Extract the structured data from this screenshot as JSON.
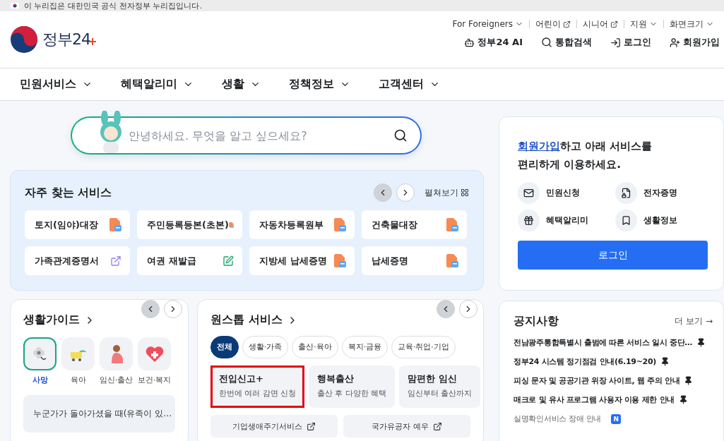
{
  "banner": {
    "text": "이 누리집은 대한민국 공식 전자정부 누리집입니다."
  },
  "logo": {
    "text": "정부24"
  },
  "utility_links": [
    {
      "label": "For Foreigners",
      "kind": "dropdown"
    },
    {
      "label": "어린이",
      "kind": "external"
    },
    {
      "label": "시니어",
      "kind": "external"
    },
    {
      "label": "지원",
      "kind": "dropdown"
    },
    {
      "label": "화면크기",
      "kind": "dropdown"
    }
  ],
  "actions": [
    {
      "label": "정부24 AI",
      "kind": "ai"
    },
    {
      "label": "통합검색",
      "kind": "search"
    },
    {
      "label": "로그인",
      "kind": "login"
    },
    {
      "label": "회원가입",
      "kind": "join"
    }
  ],
  "nav": [
    "민원서비스",
    "혜택알리미",
    "생활",
    "정책정보",
    "고객센터"
  ],
  "search": {
    "placeholder": "안녕하세요. 무엇을 알고 싶으세요?"
  },
  "frequent": {
    "title": "자주 찾는 서비스",
    "expand": "펼쳐보기",
    "prev_enabled": false,
    "items": [
      {
        "label": "토지(임야)대장",
        "kind": "document"
      },
      {
        "label": "주민등록등본(초본)",
        "kind": "document"
      },
      {
        "label": "자동차등록원부",
        "kind": "document"
      },
      {
        "label": "건축물대장",
        "kind": "document"
      },
      {
        "label": "가족관계증명서",
        "kind": "external"
      },
      {
        "label": "여권 재발급",
        "kind": "form"
      },
      {
        "label": "지방세 납세증명",
        "kind": "document"
      },
      {
        "label": "납세증명",
        "kind": "document"
      }
    ]
  },
  "member_card": {
    "link": "회원가입",
    "text": "하고 아래 서비스를",
    "text_2": "편리하게 이용하세요.",
    "services": [
      {
        "label": "민원신청",
        "kind": "mail"
      },
      {
        "label": "전자증명",
        "kind": "certificate"
      },
      {
        "label": "혜택알리미",
        "kind": "gift"
      },
      {
        "label": "생활정보",
        "kind": "bookmark"
      }
    ],
    "button": "로그인"
  },
  "life_guide": {
    "title": "생활가이드",
    "prev_enabled": false,
    "categories": [
      {
        "label": "사망",
        "kind": "death",
        "selected": true
      },
      {
        "label": "육아",
        "kind": "stroller",
        "selected": false
      },
      {
        "label": "임신·출산",
        "kind": "pregnancy",
        "selected": false
      },
      {
        "label": "보건·복지",
        "kind": "health",
        "selected": false
      }
    ],
    "items": [
      "누군가가 돌아가셨을 때(유족이 있…"
    ]
  },
  "one_stop": {
    "title": "원스톱 서비스",
    "prev_enabled": false,
    "filters": [
      {
        "label": "전체",
        "selected": true
      },
      {
        "label": "생활·가족",
        "selected": false
      },
      {
        "label": "출산·육아",
        "selected": false
      },
      {
        "label": "복지·금융",
        "selected": false
      },
      {
        "label": "교육·취업·기업",
        "selected": false
      }
    ],
    "cards": [
      {
        "title": "전입신고+",
        "subtitle": "한번에 여러 감면 신청",
        "highlighted": true
      },
      {
        "title": "행복출산",
        "subtitle": "출산 후 다양한 혜택",
        "highlighted": false
      },
      {
        "title": "맘편한 임신",
        "subtitle": "임신부터 출산까지",
        "highlighted": false
      }
    ],
    "links": [
      "기업생애주기서비스",
      "국가유공자 예우"
    ]
  },
  "notices": {
    "title": "공지사항",
    "more": "더 보기 →",
    "items": [
      {
        "text": "전남광주통합특별시 출범에 따른 서비스 일시 중단…",
        "pinned": true
      },
      {
        "text": "정부24 시스템 정기점검 안내(6.19~20)",
        "pinned": true
      },
      {
        "text": "피싱 문자 및 공공기관 위장 사이트, 웹 주의 안내",
        "pinned": true
      },
      {
        "text": "매크로 및 유사 프로그램 사용자 이용 제한 안내",
        "pinned": true
      },
      {
        "text": "실명확인서비스 장애 안내",
        "pinned": false,
        "badge": "N"
      }
    ]
  }
}
